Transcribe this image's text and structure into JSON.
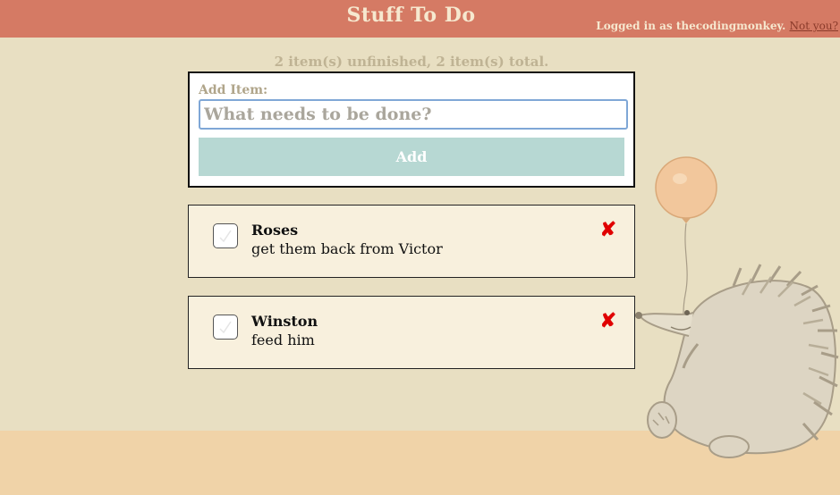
{
  "header": {
    "title": "Stuff To Do",
    "login_text": "Logged in as thecodingmonkey.",
    "not_you": "Not you?"
  },
  "summary": "2 item(s) unfinished, 2 item(s) total.",
  "add_form": {
    "label": "Add Item:",
    "placeholder": "What needs to be done?",
    "button": "Add"
  },
  "items": [
    {
      "title": "Roses",
      "description": "get them back from Victor",
      "checked": false
    },
    {
      "title": "Winston",
      "description": "feed him",
      "checked": false
    }
  ],
  "icons": {
    "delete": "delete-x-icon",
    "checkbox": "checkbox-icon",
    "illustration": "hedgehog-with-balloon"
  },
  "colors": {
    "header": "#d57a64",
    "background": "#e8dfc2",
    "floor": "#f0d3a8",
    "add_button": "#b7d8d3",
    "item_bg": "#f8f0dd",
    "delete": "#e00000"
  }
}
